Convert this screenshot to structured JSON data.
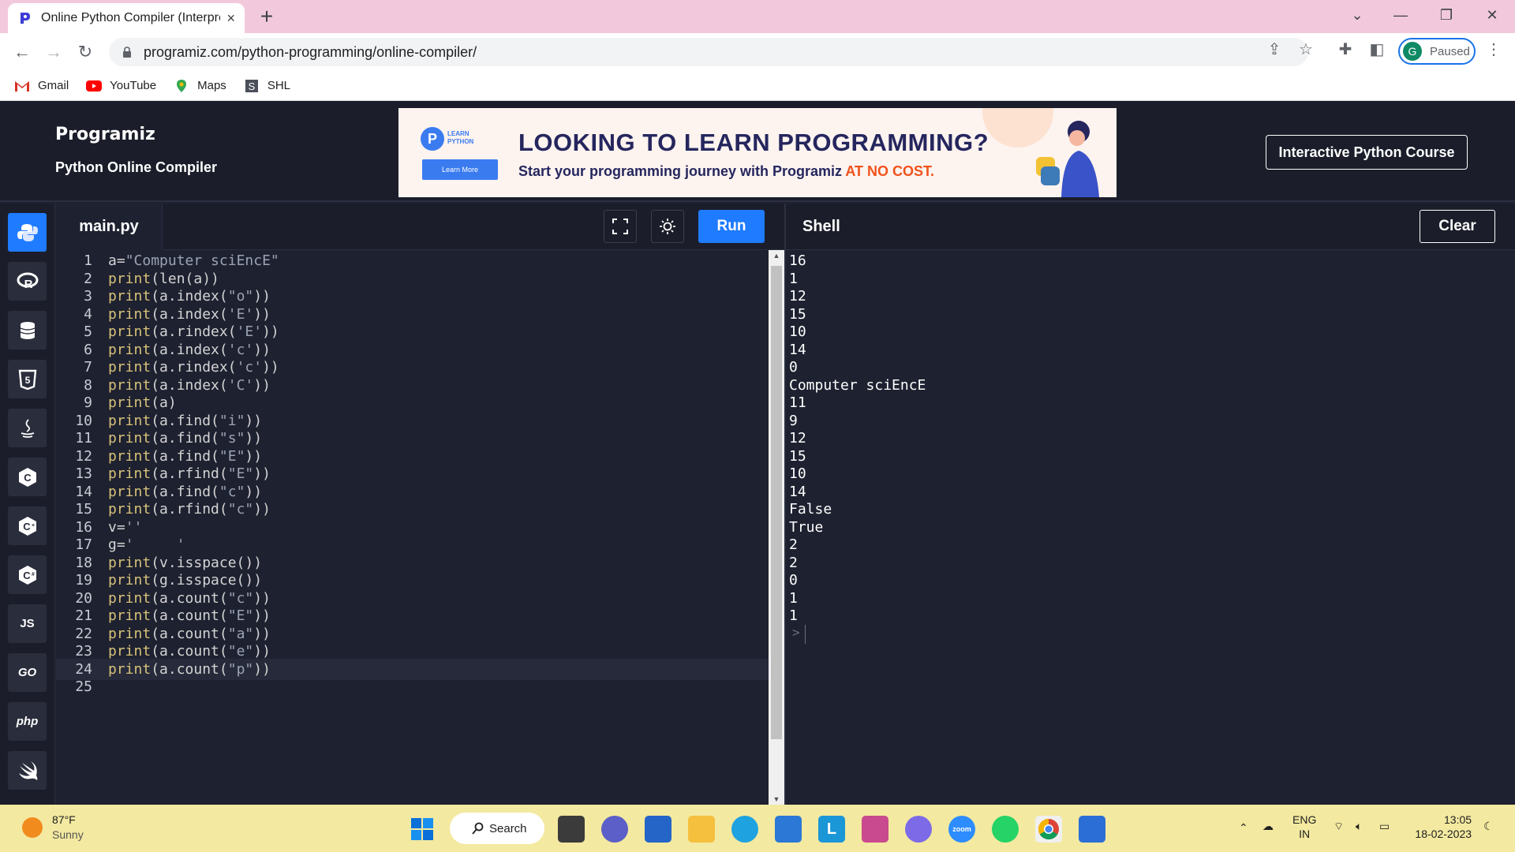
{
  "browser": {
    "tab_title": "Online Python Compiler (Interpre",
    "tab_close": "×",
    "new_tab": "+",
    "url": "programiz.com/python-programming/online-compiler/",
    "profile_initial": "G",
    "profile_status": "Paused",
    "bookmarks": [
      "Gmail",
      "YouTube",
      "Maps",
      "SHL"
    ]
  },
  "header": {
    "logo": "Programiz",
    "subtitle": "Python Online Compiler",
    "course_button": "Interactive Python Course"
  },
  "banner": {
    "badge_line1": "LEARN",
    "badge_line2": "PYTHON",
    "learn_more": "Learn More",
    "headline": "LOOKING TO LEARN PROGRAMMING?",
    "sub_prefix": "Start your programming journey with Programiz ",
    "sub_highlight": "AT NO COST."
  },
  "sidebar": {
    "languages": [
      "python",
      "r",
      "sql",
      "html",
      "java",
      "c",
      "cpp",
      "csharp",
      "JS",
      "GO",
      "php",
      "swift"
    ]
  },
  "editor": {
    "filename": "main.py",
    "run_label": "Run",
    "current_line": 24,
    "lines": [
      "a=\"Computer sciEncE\"",
      "print(len(a))",
      "print(a.index(\"o\"))",
      "print(a.index('E'))",
      "print(a.rindex('E'))",
      "print(a.index('c'))",
      "print(a.rindex('c'))",
      "print(a.index('C'))",
      "print(a)",
      "print(a.find(\"i\"))",
      "print(a.find(\"s\"))",
      "print(a.find(\"E\"))",
      "print(a.rfind(\"E\"))",
      "print(a.find(\"c\"))",
      "print(a.rfind(\"c\"))",
      "v=''",
      "g='     '",
      "print(v.isspace())",
      "print(g.isspace())",
      "print(a.count(\"c\"))",
      "print(a.count(\"E\"))",
      "print(a.count(\"a\"))",
      "print(a.count(\"e\"))",
      "print(a.count(\"p\"))",
      ""
    ]
  },
  "shell": {
    "title": "Shell",
    "clear_label": "Clear",
    "output": [
      "16",
      "1",
      "12",
      "15",
      "10",
      "14",
      "0",
      "Computer sciEncE",
      "11",
      "9",
      "12",
      "15",
      "10",
      "14",
      "False",
      "True",
      "2",
      "2",
      "0",
      "1",
      "1"
    ],
    "prompt": ">"
  },
  "taskbar": {
    "temperature": "87°F",
    "condition": "Sunny",
    "search_label": "Search",
    "language": "ENG",
    "region": "IN",
    "time": "13:05",
    "date": "18-02-2023",
    "zoom_label": "zoom"
  },
  "colors": {
    "accent": "#1f7bff",
    "editor_bg": "#1e2130",
    "print_keyword": "#d7c27a",
    "string": "#9aa3b5"
  }
}
